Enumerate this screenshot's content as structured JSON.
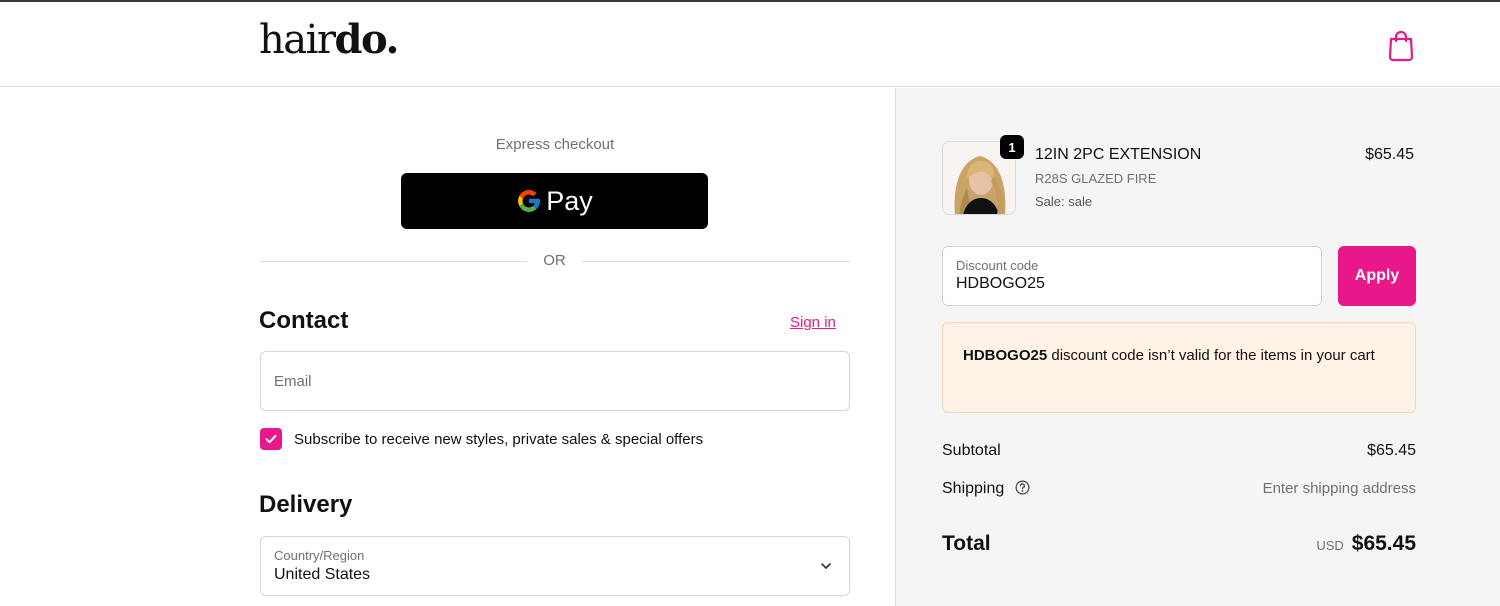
{
  "header": {
    "logo_light": "hair",
    "logo_bold": "do.",
    "cart_icon": "shopping-bag-icon"
  },
  "express": {
    "label": "Express checkout",
    "gpay_label": "Pay",
    "or_text": "OR"
  },
  "contact": {
    "title": "Contact",
    "sign_in": "Sign in",
    "email_placeholder": "Email",
    "subscribe_label": "Subscribe to receive new styles, private sales & special offers",
    "subscribe_checked": true
  },
  "delivery": {
    "title": "Delivery",
    "country_label": "Country/Region",
    "country_value": "United States"
  },
  "order": {
    "quantity": "1",
    "product_name": "12IN 2PC EXTENSION",
    "product_variant": "R28S GLAZED FIRE",
    "product_sale": "Sale: sale",
    "product_price": "$65.45",
    "discount_label": "Discount code",
    "discount_value": "HDBOGO25",
    "apply_label": "Apply",
    "alert_code": "HDBOGO25",
    "alert_text": " discount code isn’t valid for the items in your cart",
    "subtotal_label": "Subtotal",
    "subtotal_value": "$65.45",
    "shipping_label": "Shipping",
    "shipping_value": "Enter shipping address",
    "total_label": "Total",
    "total_currency": "USD",
    "total_value": "$65.45"
  },
  "colors": {
    "accent": "#e8188a",
    "alert_bg": "#fff3e8",
    "summary_bg": "#f5f5f5"
  }
}
